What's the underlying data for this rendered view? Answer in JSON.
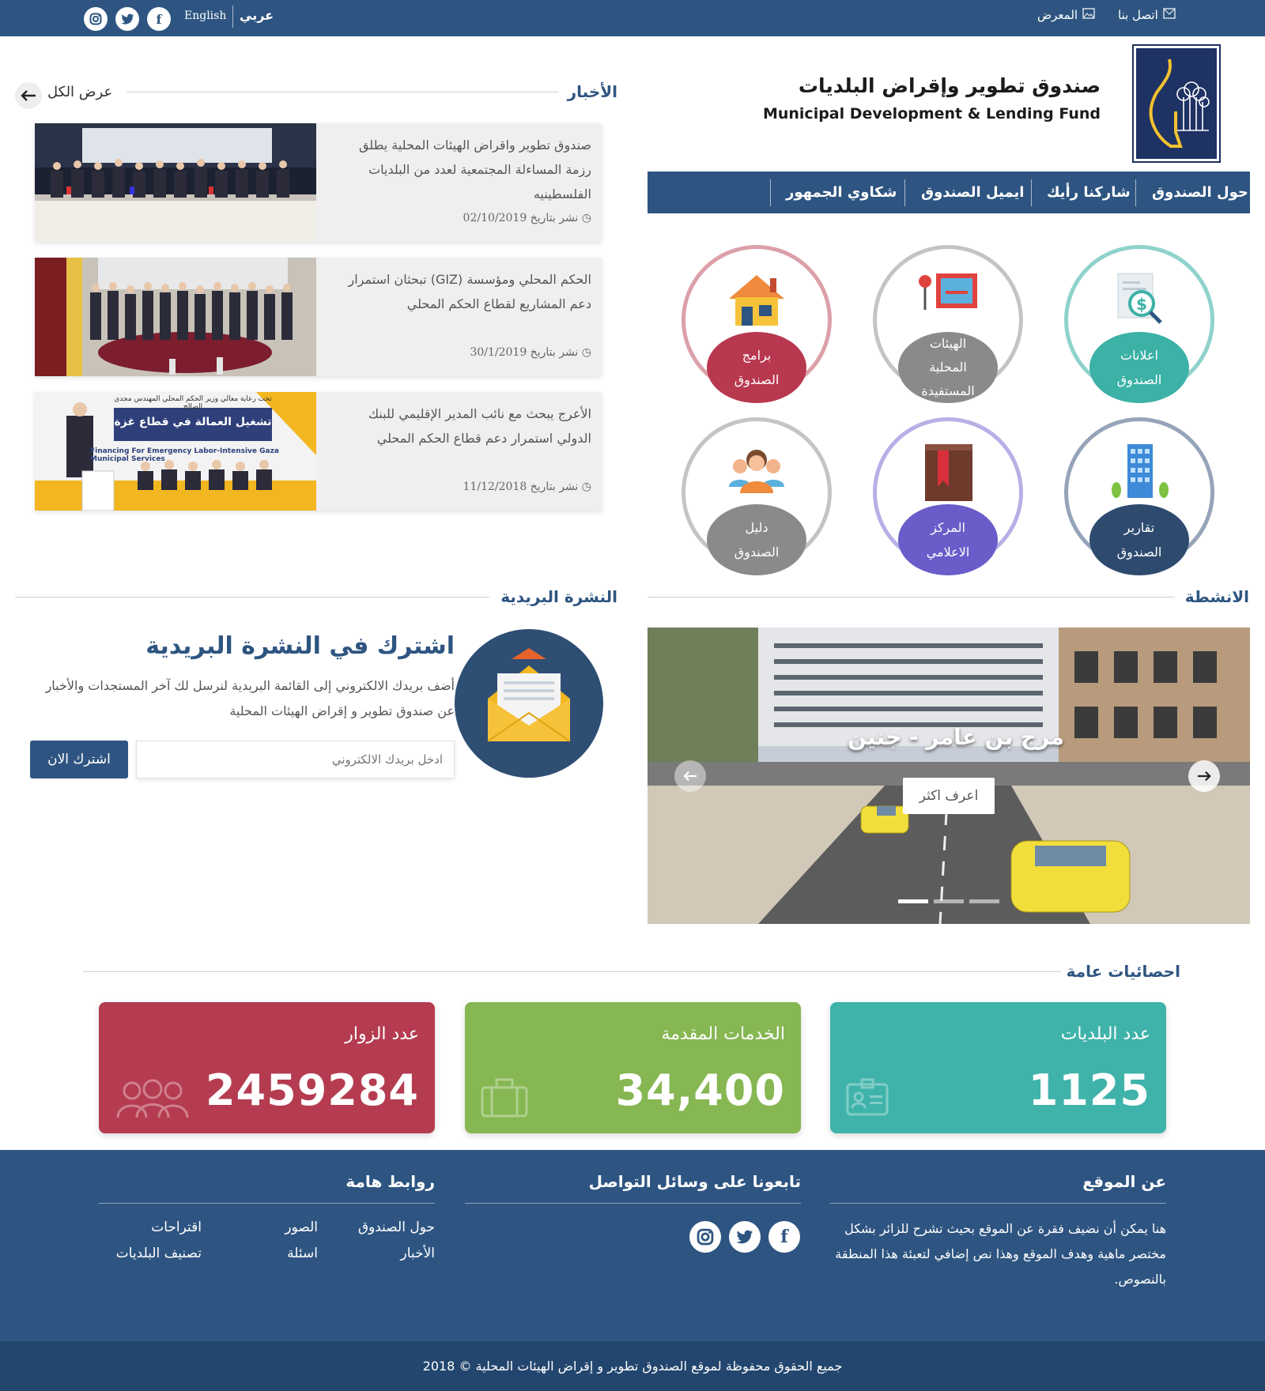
{
  "topbar": {
    "contact": "اتصل بنا",
    "gallery": "المعرض",
    "lang_ar": "عربي",
    "lang_en": "English",
    "social": [
      "f",
      "t",
      "ig"
    ]
  },
  "logo": {
    "title_ar": "صندوق تطوير وإقراض البلديات",
    "title_en": "Municipal Development & Lending Fund"
  },
  "nav": [
    "حول الصندوق",
    "شاركنا رأيك",
    "ايميل الصندوق",
    "شكاوي الجمهور"
  ],
  "services": [
    {
      "l1": "اعلانات",
      "l2": "الصندوق",
      "l3": "",
      "color": "#3cb1a6",
      "ring": "#8fd2cc",
      "icon": "ad-search-icon"
    },
    {
      "l1": "الهيئات",
      "l2": "المحلية",
      "l3": "المستفيدة",
      "color": "#8a8a8a",
      "ring": "#c4c4c4",
      "icon": "bulletin-board-icon"
    },
    {
      "l1": "برامج",
      "l2": "الصندوق",
      "l3": "",
      "color": "#b8384f",
      "ring": "#dca0a9",
      "icon": "house-icon"
    },
    {
      "l1": "تقارير",
      "l2": "الصندوق",
      "l3": "",
      "color": "#2e4a6f",
      "ring": "#95a4b8",
      "icon": "building-icon"
    },
    {
      "l1": "المركز",
      "l2": "الاعلامي",
      "l3": "",
      "color": "#6a5cc9",
      "ring": "#b7b0e6",
      "icon": "book-icon"
    },
    {
      "l1": "دليل",
      "l2": "الصندوق",
      "l3": "",
      "color": "#8a8a8a",
      "ring": "#c4c4c4",
      "icon": "people-icon"
    }
  ],
  "news": {
    "title": "الأخبار",
    "view_all": "عرض الكل",
    "items": [
      {
        "text": "صندوق تطوير واقراض الهيئات المحلية يطلق رزمة المساءلة المجتمعية لعدد من البلديات الفلسطينيه",
        "date": "نشر بتاريخ 02/10/2019"
      },
      {
        "text": "الحكم المحلي ومؤسسة (GIZ) تبحثان استمرار دعم المشاريع لقطاع الحكم المحلي",
        "date": "نشر بتاريخ 30/1/2019"
      },
      {
        "text": "الأعرج يبحث مع نائب المدير الإقليمي للبنك الدولي استمرار دعم قطاع الحكم المحلي",
        "date": "نشر بتاريخ 11/12/2018"
      }
    ],
    "img3_heading": "تشغيل العمالة في قطاع غزة",
    "img3_sub": "Financing For Emergency Labor-Intensive Gaza Municipal Services",
    "img3_top": "تحت رعاية معالي وزير الحكم المحلي المهندس مجدي الصالح"
  },
  "activities": {
    "title": "الانشطة",
    "slide_caption": "مرج بن عامر - جنين",
    "slide_button": "اعرف اكثر",
    "dots": 3
  },
  "newsletter": {
    "title": "النشرة البريدية",
    "heading": "اشترك في النشرة البريدية",
    "desc": "أضف بريدك الالكتروني إلى القائمة البريدية لنرسل لك آخر المستجدات والأخبار عن صندوق تطوير و إقراض الهيئات المحلية",
    "placeholder": "ادخل بريدك الالكتروني",
    "button": "اشترك الان"
  },
  "stats": {
    "title": "احصائيات عامة",
    "items": [
      {
        "label": "عدد البلديات",
        "value": "1125",
        "color": "#3fb3aa",
        "icon": "id-card-icon"
      },
      {
        "label": "الخدمات المقدمة",
        "value": "34,400",
        "color": "#86b752",
        "icon": "briefcase-icon"
      },
      {
        "label": "عدد الزوار",
        "value": "2459284",
        "color": "#b53c50",
        "icon": "users-icon"
      }
    ]
  },
  "footer": {
    "about_title": "عن الموقع",
    "about_text": "هنا يمكن أن نضيف فقرة عن الموقع بحيث تشرح للزائر بشكل مختصر ماهية وهدف الموقع وهذا نص إضافي لتعبئة هذا المنطقة بالنصوص.",
    "social_title": "تابعونا على وسائل التواصل",
    "links_title": "روابط هامة",
    "links": [
      "حول الصندوق",
      "الصور",
      "اقتراحات",
      "الأخبار",
      "اسئلة",
      "تصنيف البلديات"
    ],
    "copyright": "جميع الحقوق محفوظة لموقع الصندوق تطوير و إقراض الهيئات المحلية © 2018"
  }
}
